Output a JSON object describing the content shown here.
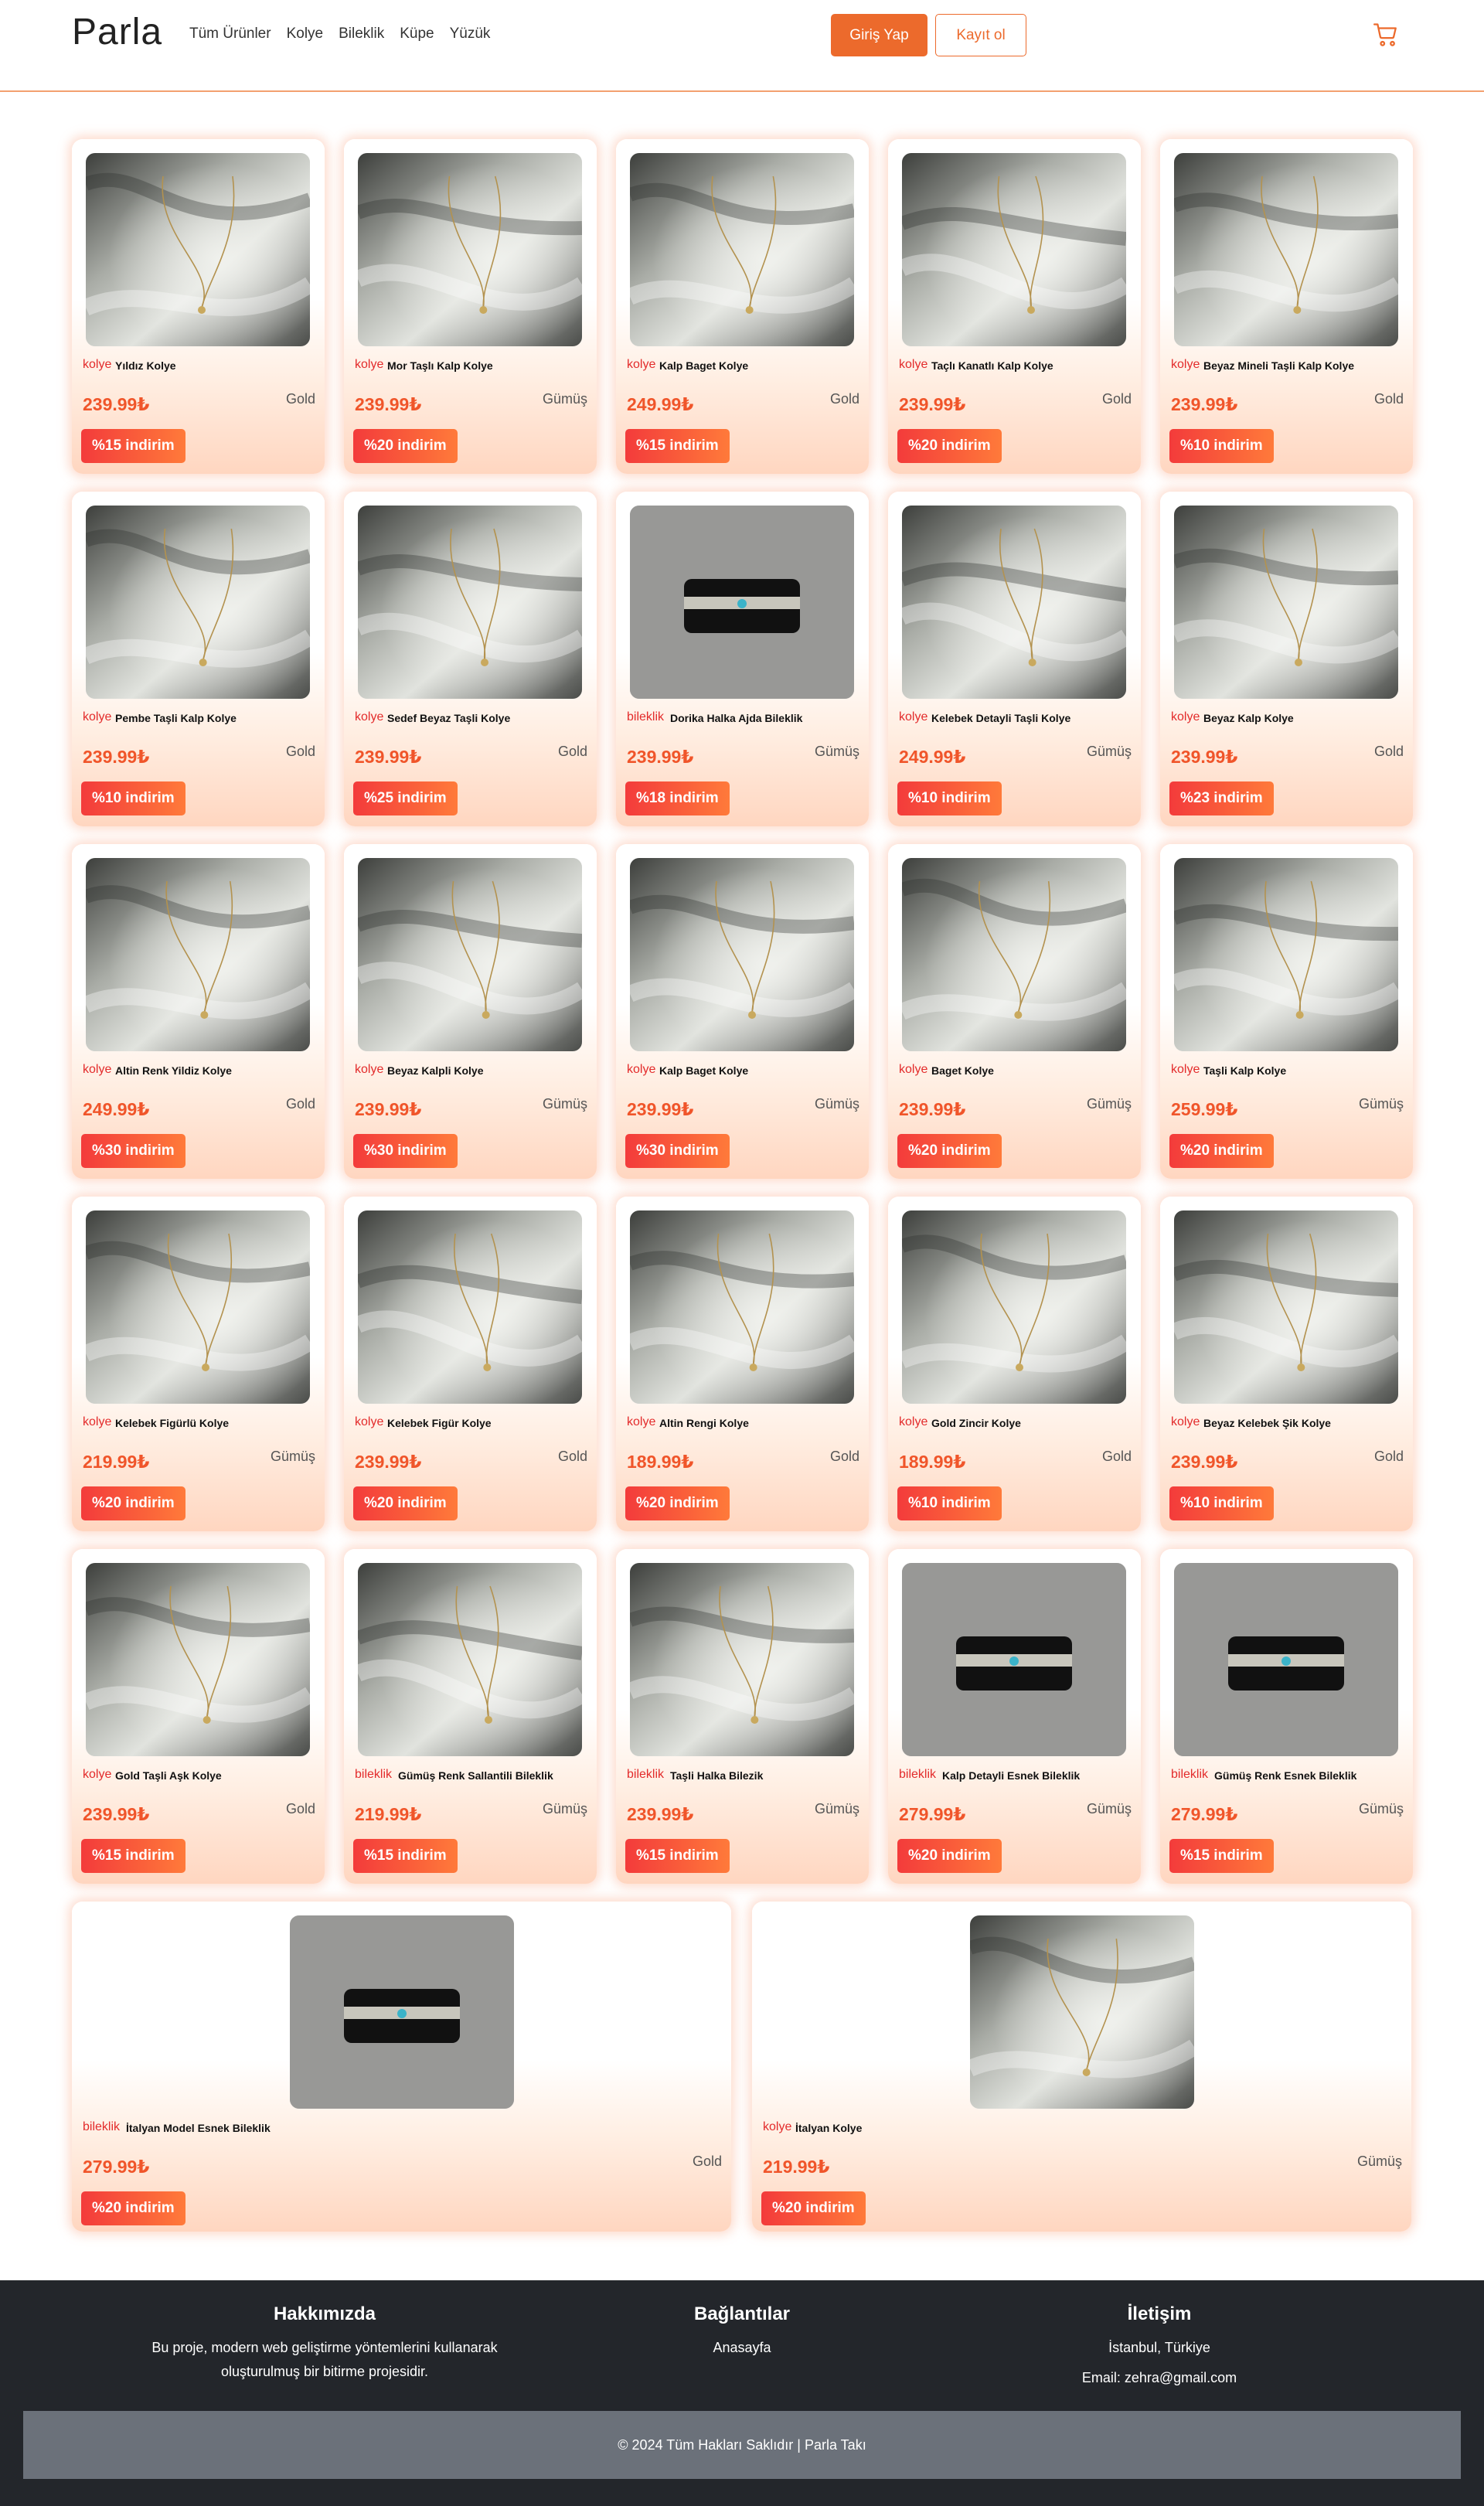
{
  "brand": "Parla",
  "nav": [
    "Tüm Ürünler",
    "Kolye",
    "Bileklik",
    "Küpe",
    "Yüzük"
  ],
  "auth": {
    "login": "Giriş Yap",
    "register": "Kayıt ol"
  },
  "cart_icon": "shopping-cart-icon",
  "products": [
    {
      "category": "kolye",
      "name": "Yıldız Kolye",
      "price": "239.99₺",
      "material": "Gold",
      "discount": "%15 indirim",
      "photo": "silk"
    },
    {
      "category": "kolye",
      "name": "Mor Taşlı Kalp Kolye",
      "price": "239.99₺",
      "material": "Gümüş",
      "discount": "%20 indirim",
      "photo": "silk"
    },
    {
      "category": "kolye",
      "name": "Kalp Baget Kolye",
      "price": "249.99₺",
      "material": "Gold",
      "discount": "%15 indirim",
      "photo": "silk"
    },
    {
      "category": "kolye",
      "name": "Taçlı Kanatlı Kalp Kolye",
      "price": "239.99₺",
      "material": "Gold",
      "discount": "%20 indirim",
      "photo": "silk"
    },
    {
      "category": "kolye",
      "name": "Beyaz Mineli Taşli Kalp Kolye",
      "price": "239.99₺",
      "material": "Gold",
      "discount": "%10 indirim",
      "photo": "silk"
    },
    {
      "category": "kolye",
      "name": "Pembe Taşli Kalp Kolye",
      "price": "239.99₺",
      "material": "Gold",
      "discount": "%10 indirim",
      "photo": "silk"
    },
    {
      "category": "kolye",
      "name": "Sedef Beyaz Taşli Kolye",
      "price": "239.99₺",
      "material": "Gold",
      "discount": "%25 indirim",
      "photo": "silk"
    },
    {
      "category": "bileklik",
      "name": "Dorika Halka Ajda Bileklik",
      "price": "239.99₺",
      "material": "Gümüş",
      "discount": "%18 indirim",
      "photo": "stand"
    },
    {
      "category": "kolye",
      "name": "Kelebek Detayli Taşli Kolye",
      "price": "249.99₺",
      "material": "Gümüş",
      "discount": "%10 indirim",
      "photo": "silk"
    },
    {
      "category": "kolye",
      "name": "Beyaz Kalp Kolye",
      "price": "239.99₺",
      "material": "Gold",
      "discount": "%23 indirim",
      "photo": "silk"
    },
    {
      "category": "kolye",
      "name": "Altin Renk Yildiz Kolye",
      "price": "249.99₺",
      "material": "Gold",
      "discount": "%30 indirim",
      "photo": "silk"
    },
    {
      "category": "kolye",
      "name": "Beyaz Kalpli Kolye",
      "price": "239.99₺",
      "material": "Gümüş",
      "discount": "%30 indirim",
      "photo": "silk"
    },
    {
      "category": "kolye",
      "name": "Kalp Baget Kolye",
      "price": "239.99₺",
      "material": "Gümüş",
      "discount": "%30 indirim",
      "photo": "silk"
    },
    {
      "category": "kolye",
      "name": "Baget Kolye",
      "price": "239.99₺",
      "material": "Gümüş",
      "discount": "%20 indirim",
      "photo": "silk"
    },
    {
      "category": "kolye",
      "name": "Taşli Kalp Kolye",
      "price": "259.99₺",
      "material": "Gümüş",
      "discount": "%20 indirim",
      "photo": "silk"
    },
    {
      "category": "kolye",
      "name": "Kelebek Figürlü Kolye",
      "price": "219.99₺",
      "material": "Gümüş",
      "discount": "%20 indirim",
      "photo": "silk"
    },
    {
      "category": "kolye",
      "name": "Kelebek Figür Kolye",
      "price": "239.99₺",
      "material": "Gold",
      "discount": "%20 indirim",
      "photo": "silk"
    },
    {
      "category": "kolye",
      "name": "Altin Rengi Kolye",
      "price": "189.99₺",
      "material": "Gold",
      "discount": "%20 indirim",
      "photo": "silk"
    },
    {
      "category": "kolye",
      "name": "Gold Zincir Kolye",
      "price": "189.99₺",
      "material": "Gold",
      "discount": "%10 indirim",
      "photo": "silk"
    },
    {
      "category": "kolye",
      "name": "Beyaz Kelebek Şik Kolye",
      "price": "239.99₺",
      "material": "Gold",
      "discount": "%10 indirim",
      "photo": "silk"
    },
    {
      "category": "kolye",
      "name": "Gold Taşli Aşk Kolye",
      "price": "239.99₺",
      "material": "Gold",
      "discount": "%15 indirim",
      "photo": "silk"
    },
    {
      "category": "bileklik",
      "name": "Gümüş Renk Sallantili Bileklik",
      "price": "219.99₺",
      "material": "Gümüş",
      "discount": "%15 indirim",
      "photo": "silk"
    },
    {
      "category": "bileklik",
      "name": "Taşli Halka Bilezik",
      "price": "239.99₺",
      "material": "Gümüş",
      "discount": "%15 indirim",
      "photo": "silk"
    },
    {
      "category": "bileklik",
      "name": "Kalp Detayli Esnek Bileklik",
      "price": "279.99₺",
      "material": "Gümüş",
      "discount": "%20 indirim",
      "photo": "stand"
    },
    {
      "category": "bileklik",
      "name": "Gümüş Renk Esnek Bileklik",
      "price": "279.99₺",
      "material": "Gümüş",
      "discount": "%15 indirim",
      "photo": "stand"
    },
    {
      "category": "bileklik",
      "name": "İtalyan Model Esnek Bileklik",
      "price": "279.99₺",
      "material": "Gold",
      "discount": "%20 indirim",
      "photo": "stand"
    },
    {
      "category": "kolye",
      "name": "İtalyan Kolye",
      "price": "219.99₺",
      "material": "Gümüş",
      "discount": "%20 indirim",
      "photo": "silk"
    }
  ],
  "footer": {
    "about_title": "Hakkımızda",
    "about_text_1": "Bu proje, modern web geliştirme yöntemlerini kullanarak",
    "about_text_2": "oluşturulmuş bir bitirme projesidir.",
    "links_title": "Bağlantılar",
    "links": [
      "Anasayfa"
    ],
    "contact_title": "İletişim",
    "contact_location": "İstanbul, Türkiye",
    "contact_email": "Email: zehra@gmail.com",
    "copyright": "© 2024 Tüm Hakları Saklıdır | Parla Takı"
  }
}
